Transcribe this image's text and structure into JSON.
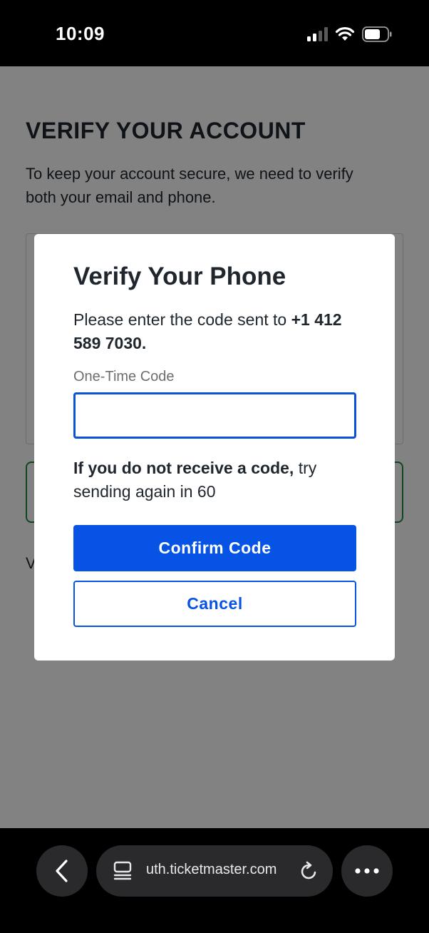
{
  "status_bar": {
    "time": "10:09"
  },
  "page": {
    "title": "VERIFY YOUR ACCOUNT",
    "description": "To keep your account secure, we need to verify both your email and phone.",
    "partial_text": "V"
  },
  "modal": {
    "title": "Verify Your Phone",
    "desc_prefix": "Please enter the code sent to ",
    "phone_number": "+1 412 589 7030.",
    "code_label": "One-Time Code",
    "code_value": "",
    "resend_bold": "If you do not receive a code,",
    "resend_rest": " try sending again in 60",
    "confirm_label": "Confirm Code",
    "cancel_label": "Cancel",
    "accent_color": "#0653e6"
  },
  "browser": {
    "url": "uth.ticketmaster.com",
    "icons": [
      "chevron-left-icon",
      "tab-overview-icon",
      "reload-icon",
      "more-icon"
    ]
  }
}
